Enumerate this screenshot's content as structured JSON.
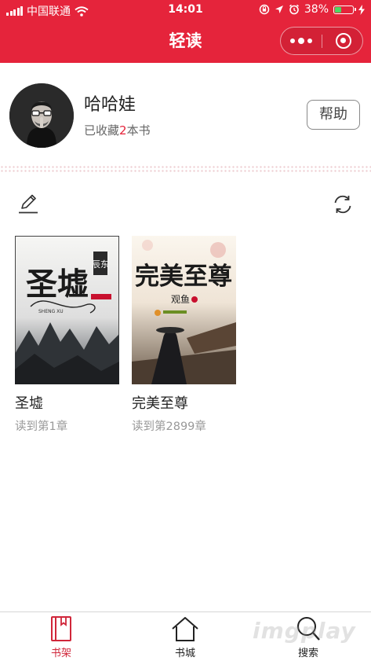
{
  "status_bar": {
    "carrier": "中国联通",
    "time": "14:01",
    "battery": "38%",
    "battery_level": 0.38
  },
  "nav": {
    "title": "轻读"
  },
  "profile": {
    "name": "哈哈娃",
    "collect_prefix": "已收藏",
    "collect_count": "2",
    "collect_suffix": "本书",
    "help_label": "帮助"
  },
  "toolbar": {
    "edit_icon": "pencil-icon",
    "sync_icon": "sync-icon"
  },
  "books": [
    {
      "title": "圣墟",
      "progress": "读到第1章",
      "cover_text": "圣墟",
      "cover_sub": "SHENG XU",
      "cover_badge": "辰东"
    },
    {
      "title": "完美至尊",
      "progress": "读到第2899章",
      "cover_text": "完美至尊",
      "cover_author": "观鱼"
    }
  ],
  "tabbar": {
    "items": [
      {
        "label": "书架",
        "active": true
      },
      {
        "label": "书城",
        "active": false
      },
      {
        "label": "搜索",
        "active": false
      }
    ]
  },
  "colors": {
    "brand": "#e5243b",
    "active_tab": "#d0263a"
  },
  "watermark": "imgplay"
}
